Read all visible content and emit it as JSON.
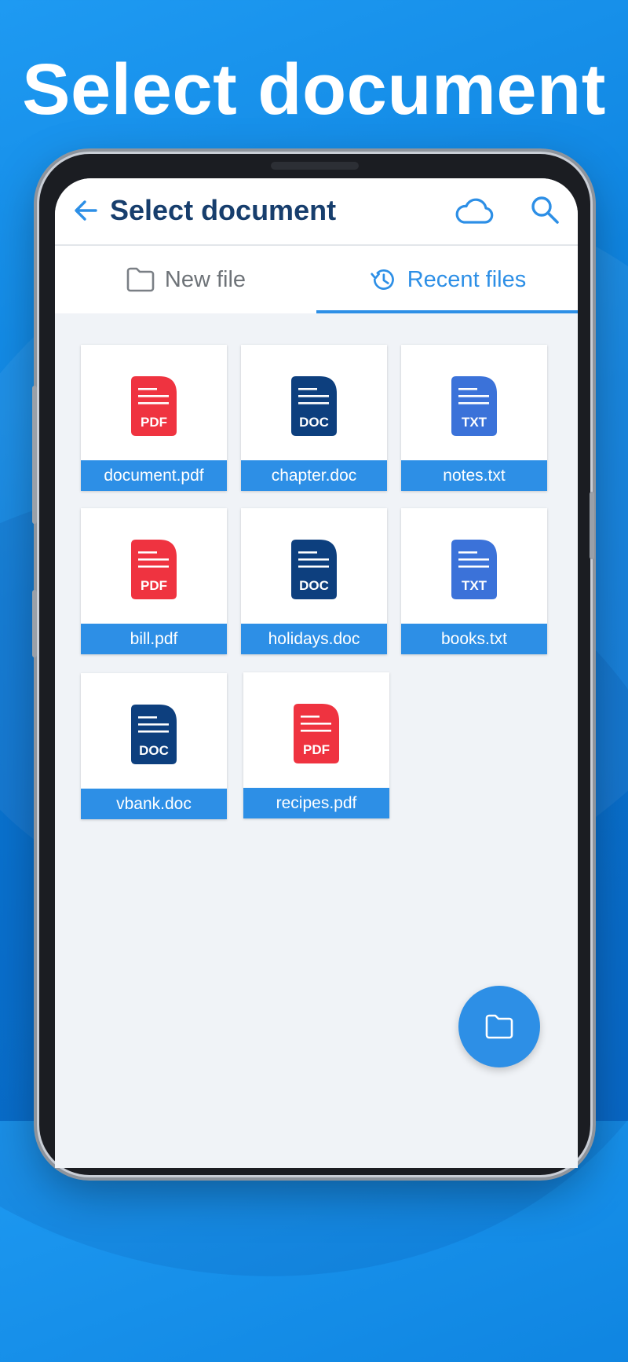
{
  "hero": {
    "title": "Select document"
  },
  "appbar": {
    "title": "Select document"
  },
  "tabs": [
    {
      "label": "New file",
      "icon": "folder-outline-icon",
      "active": false
    },
    {
      "label": "Recent files",
      "icon": "history-icon",
      "active": true
    }
  ],
  "files": [
    {
      "name": "document.pdf",
      "type": "PDF"
    },
    {
      "name": "chapter.doc",
      "type": "DOC"
    },
    {
      "name": "notes.txt",
      "type": "TXT"
    },
    {
      "name": "bill.pdf",
      "type": "PDF"
    },
    {
      "name": "holidays.doc",
      "type": "DOC"
    },
    {
      "name": "books.txt",
      "type": "TXT"
    },
    {
      "name": "vbank.doc",
      "type": "DOC"
    },
    {
      "name": "recipes.pdf",
      "type": "PDF"
    }
  ],
  "colors": {
    "PDF": "#ef3340",
    "DOC": "#0d3f7e",
    "TXT": "#3b72d9",
    "accent": "#2d8fe6",
    "title": "#173e6d"
  }
}
